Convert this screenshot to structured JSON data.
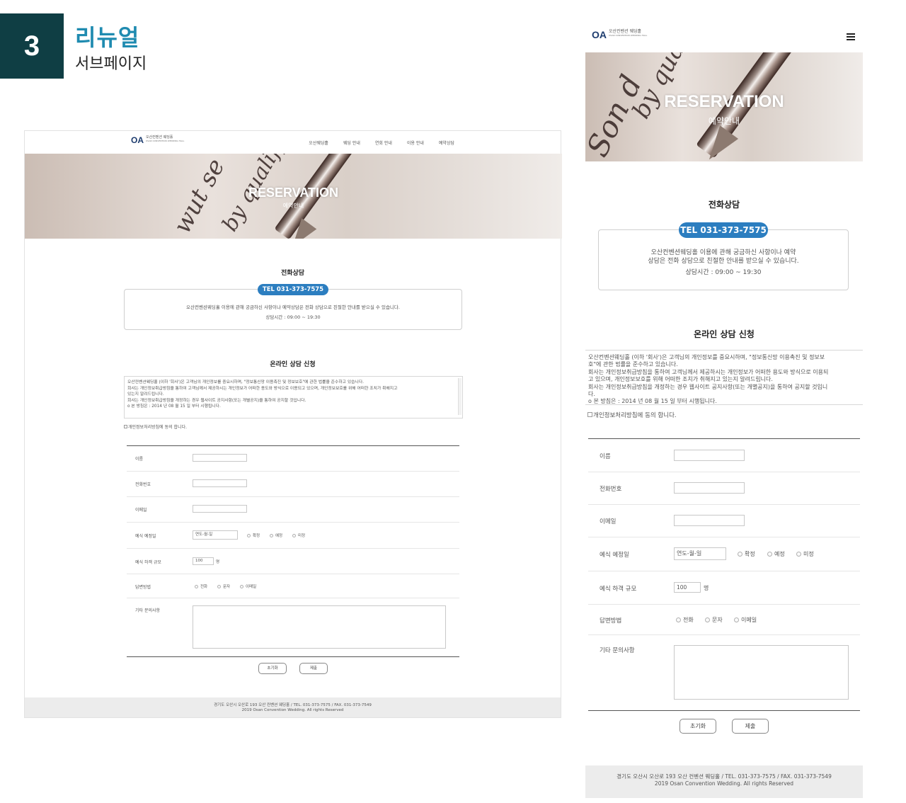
{
  "header": {
    "number": "3",
    "title": "리뉴얼",
    "subtitle": "서브페이지"
  },
  "site": {
    "logo_mark": "OA",
    "logo_korean": "오산컨벤션 웨딩홀",
    "logo_english": "OSAN CONVENTION WEDDING HALL",
    "menu": [
      "오산웨딩홀",
      "웨딩 안내",
      "연회 안내",
      "이용 안내",
      "예약상담"
    ],
    "hero_title": "RESERVATION",
    "hero_subtitle": "예약안내",
    "phone_section_title": "전화상담",
    "tel": "TEL 031-373-7575",
    "phone_desc_desktop": "오산컨벤션웨딩홀 이용에 관해 궁금하신 사항이나 예약상담은 전화 상담으로 친절한 안내를 받으실 수 있습니다.",
    "phone_desc_mobile_1": "오산컨벤션웨딩홀 이용에 관해 궁금하신 사항이나 예약",
    "phone_desc_mobile_2": "상담은 전화 상담으로 친절한 안내를 받으실 수 있습니다.",
    "hours": "상담시간 : 09:00 ~ 19:30",
    "online_title": "온라인 상담 신청",
    "policy_desktop": [
      "오산컨벤션웨딩홀 (이하 '회사')은 고객님의 개인정보를 중요시하며, \"정보통신망 이용촉진 및 정보보호\"에 관한 법률을 준수하고 있습니다.",
      "회사는 개인정보취급방침을 통하여 고객님께서 제공하시는 개인정보가 어떠한 용도와 방식으로 이용되고 있으며, 개인정보보호를 위해 어떠한 조치가 취해지고",
      "있는지 알려드립니다.",
      "회사는 개인정보취급방침을 개정하는 경우 웹사이트 공지사항(또는 개별공지)을 통하여 공지할 것입니다.",
      "o 본 방침은 : 2014 년 08 월 15 일 부터 시행됩니다."
    ],
    "policy_mobile": [
      "오산컨벤션웨딩홀 (이하 '회사')은 고객님의 개인정보를 중요시하며, \"정보통신망 이용촉진 및 정보보",
      "호\"에 관한 법률을 준수하고 있습니다.",
      "회사는 개인정보취급방침을 통하여 고객님께서 제공하시는 개인정보가 어떠한 용도와 방식으로 이용되",
      "고 있으며, 개인정보보호를 위해 어떠한 조치가 취해지고 있는지 알려드립니다.",
      "회사는 개인정보취급방침을 개정하는 경우 웹사이트 공지사항(또는 개별공지)을 통하여 공지할 것입니",
      "다.",
      "o 본 방침은 : 2014 년 08 월 15 일 부터 시행됩니다."
    ],
    "agree": "개인정보처리방침에 동의 합니다.",
    "form": {
      "name_label": "이름",
      "phone_label": "전화번호",
      "email_label": "이메일",
      "date_label": "예식 예정일",
      "date_placeholder": "연도-월-일",
      "date_options": [
        "확정",
        "예정",
        "미정"
      ],
      "guests_label": "예식 하객 규모",
      "guests_value": "100",
      "guests_unit": "명",
      "reply_label": "답변방법",
      "reply_options": [
        "전화",
        "문자",
        "이메일"
      ],
      "etc_label": "기타 문의사항"
    },
    "reset_button": "초기화",
    "submit_button": "제출",
    "footer_line1": "경기도 오산시 오산로 193 오산 컨벤션 웨딩홀 / TEL. 031-373-7575 / FAX. 031-373-7549",
    "footer_line2": "2019 Osan Convention Wedding. All rights Reserved"
  }
}
